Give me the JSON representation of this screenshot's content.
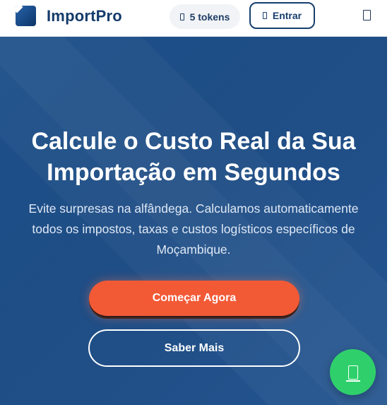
{
  "header": {
    "brand": "ImportPro",
    "logo_icon": "cube-logo-icon",
    "tokens_label": "5 tokens",
    "tokens_icon": "token-icon",
    "login_label": "Entrar",
    "login_icon": "login-icon",
    "menu_icon": "menu-icon"
  },
  "hero": {
    "title": "Calcule o Custo Real da Sua Importação em Segundos",
    "subtitle": "Evite surpresas na alfândega. Calculamos automaticamente todos os impostos, taxas e custos logísticos específicos de Moçambique.",
    "primary_cta": "Começar Agora",
    "secondary_cta": "Saber Mais"
  },
  "fab": {
    "icon": "whatsapp-icon"
  },
  "colors": {
    "brand_navy": "#143b6b",
    "hero_blue": "#1f4d85",
    "cta_orange": "#f25a36",
    "fab_green": "#2fd06b"
  }
}
